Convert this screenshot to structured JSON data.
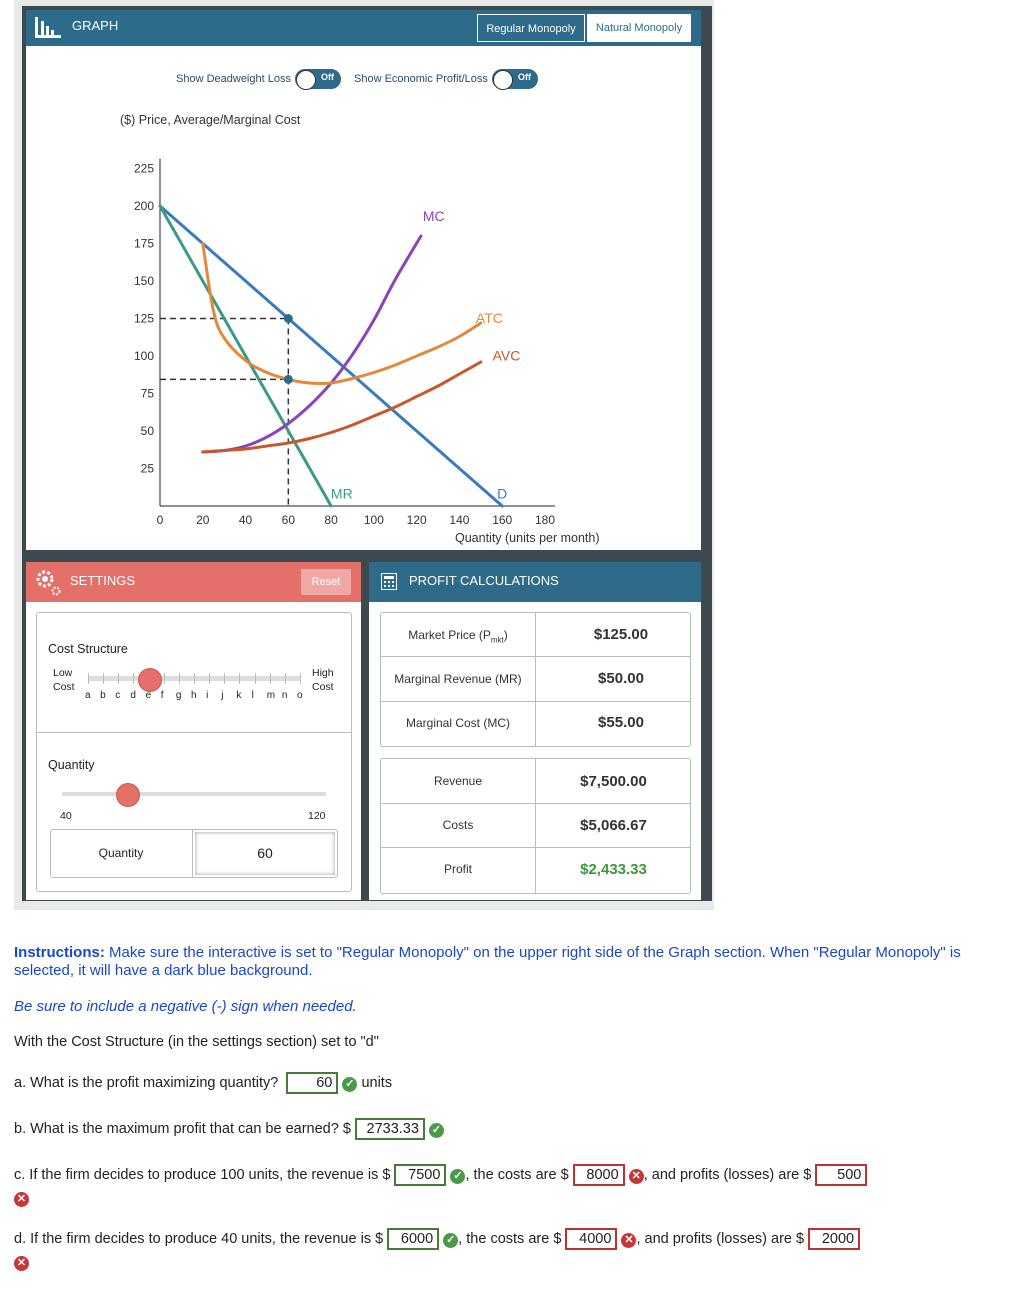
{
  "graph": {
    "title": "GRAPH",
    "tabs": [
      "Regular Monopoly",
      "Natural Monopoly"
    ],
    "toggle1_label": "Show Deadweight Loss",
    "toggle2_label": "Show Economic Profit/Loss",
    "toggle_state": "Off"
  },
  "chart_data": {
    "type": "line",
    "ylabel": "($) Price, Average/Marginal Cost",
    "xlabel": "Quantity (units per month)",
    "xlim": [
      0,
      180
    ],
    "ylim": [
      0,
      225
    ],
    "x_ticks": [
      0,
      20,
      40,
      60,
      80,
      100,
      120,
      140,
      160,
      180
    ],
    "y_ticks": [
      25,
      50,
      75,
      100,
      125,
      150,
      175,
      200,
      225
    ],
    "series": [
      {
        "name": "D",
        "color": "#3a7bbf",
        "points": [
          [
            0,
            200
          ],
          [
            160,
            0
          ]
        ]
      },
      {
        "name": "MR",
        "color": "#3a9a85",
        "points": [
          [
            0,
            200
          ],
          [
            80,
            0
          ]
        ]
      },
      {
        "name": "MC",
        "color": "#8a44b8",
        "points": [
          [
            20,
            36
          ],
          [
            30,
            37
          ],
          [
            40,
            40
          ],
          [
            50,
            46
          ],
          [
            60,
            55
          ],
          [
            70,
            67
          ],
          [
            80,
            82
          ],
          [
            90,
            101
          ],
          [
            100,
            124
          ],
          [
            110,
            151
          ],
          [
            122,
            180
          ]
        ]
      },
      {
        "name": "ATC",
        "color": "#e38a3a",
        "points": [
          [
            20,
            175
          ],
          [
            25,
            130
          ],
          [
            30,
            112
          ],
          [
            40,
            97
          ],
          [
            50,
            89
          ],
          [
            60,
            84.4
          ],
          [
            70,
            82
          ],
          [
            80,
            82
          ],
          [
            90,
            85
          ],
          [
            100,
            89
          ],
          [
            110,
            94
          ],
          [
            120,
            100
          ],
          [
            130,
            106
          ],
          [
            140,
            113
          ],
          [
            150,
            122
          ]
        ]
      },
      {
        "name": "AVC",
        "color": "#c8582a",
        "points": [
          [
            20,
            36
          ],
          [
            30,
            37
          ],
          [
            40,
            38
          ],
          [
            50,
            40
          ],
          [
            60,
            42
          ],
          [
            70,
            45
          ],
          [
            80,
            49
          ],
          [
            90,
            54
          ],
          [
            100,
            60
          ],
          [
            110,
            66
          ],
          [
            120,
            73
          ],
          [
            130,
            80
          ],
          [
            140,
            88
          ],
          [
            150,
            96
          ]
        ]
      }
    ],
    "annotations": [
      {
        "label": "Q",
        "x": 60,
        "y": 125
      },
      {
        "label": "ATC at Q",
        "x": 60,
        "y": 84.4
      }
    ]
  },
  "settings": {
    "title": "SETTINGS",
    "reset": "Reset",
    "cost_structure_label": "Cost Structure",
    "low": [
      "Low",
      "Cost"
    ],
    "high": [
      "High",
      "Cost"
    ],
    "letters": [
      "a",
      "b",
      "c",
      "d",
      "e",
      "f",
      "g",
      "h",
      "i",
      "j",
      "k",
      "l",
      "m",
      "n",
      "o"
    ],
    "selected_letter": "d",
    "quantity_label": "Quantity",
    "q_min": "40",
    "q_max": "120",
    "q_value": 60,
    "q_input_label": "Quantity",
    "q_input_value": "60"
  },
  "calc": {
    "title": "PROFIT CALCULATIONS",
    "rows1": [
      {
        "label": "Market Price (P",
        "sub": "mkt",
        "label_end": ")",
        "value": "$125.00"
      },
      {
        "label": "Marginal Revenue (MR)",
        "value": "$50.00"
      },
      {
        "label": "Marginal Cost (MC)",
        "value": "$55.00"
      }
    ],
    "rows2": [
      {
        "label": "Revenue",
        "value": "$7,500.00"
      },
      {
        "label": "Costs",
        "value": "$5,066.67"
      },
      {
        "label": "Profit",
        "value": "$2,433.33",
        "color": "#3a9a3a"
      }
    ]
  },
  "instructions": {
    "bold": "Instructions:",
    "text": " Make sure the interactive is set to \"Regular Monopoly\" on the upper right side of the Graph section. When \"Regular Monopoly\" is selected, it will have a dark blue background.",
    "note": "Be sure to include a negative (-) sign when needed.",
    "setup": "With the Cost Structure (in the settings section) set to \"d\""
  },
  "questions": {
    "a_text": "a. What is the profit maximizing quantity?",
    "a_ans": "60",
    "a_unit": "units",
    "b_text": "b. What is the maximum profit that can be earned? $",
    "b_ans": "2733.33",
    "c_text1": "c. If the firm decides to produce 100 units, the revenue is $",
    "c_rev": "7500",
    "c_text2": ", the costs are $",
    "c_cost": "8000",
    "c_text3": ", and profits (losses) are $",
    "c_prof": "500",
    "d_text1": "d. If the firm decides to produce 40 units, the revenue is $",
    "d_rev": "6000",
    "d_text2": ", the costs are $",
    "d_cost": "4000",
    "d_text3": ", and profits (losses) are $",
    "d_prof": "2000"
  }
}
